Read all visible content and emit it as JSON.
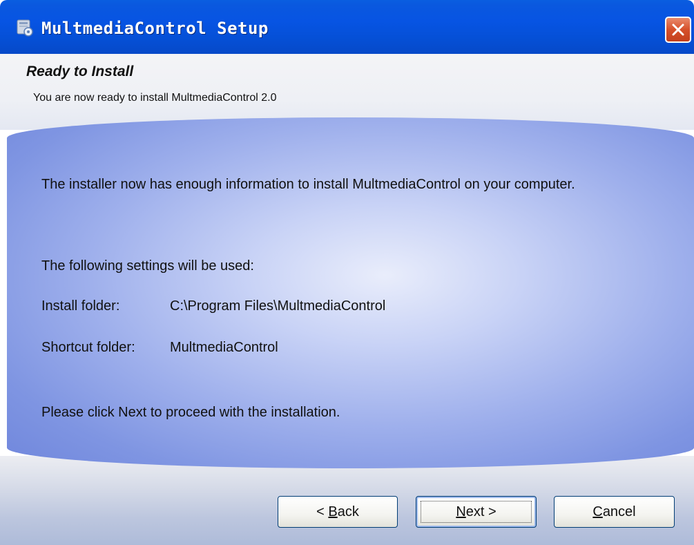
{
  "window": {
    "title": "MultmediaControl Setup"
  },
  "header": {
    "title": "Ready to Install",
    "subtitle": "You are now ready to install MultmediaControl 2.0"
  },
  "content": {
    "intro": "The installer now has enough information to install MultmediaControl on your computer.",
    "settings_heading": "The following settings will be used:",
    "install_folder_label": "Install folder:",
    "install_folder_value": "C:\\Program Files\\MultmediaControl",
    "shortcut_folder_label": "Shortcut folder:",
    "shortcut_folder_value": "MultmediaControl",
    "proceed_text": "Please click Next to proceed with the installation."
  },
  "buttons": {
    "back_prefix": "< ",
    "back_mnemonic": "B",
    "back_rest": "ack",
    "next_mnemonic": "N",
    "next_rest": "ext >",
    "cancel_mnemonic": "C",
    "cancel_rest": "ancel"
  },
  "icons": {
    "app": "setup-app-icon",
    "close": "close-icon"
  },
  "colors": {
    "titlebar": "#0754e3",
    "close_button": "#d6502a",
    "content_center": "#e9edfb",
    "content_edge": "#6f86dc"
  }
}
